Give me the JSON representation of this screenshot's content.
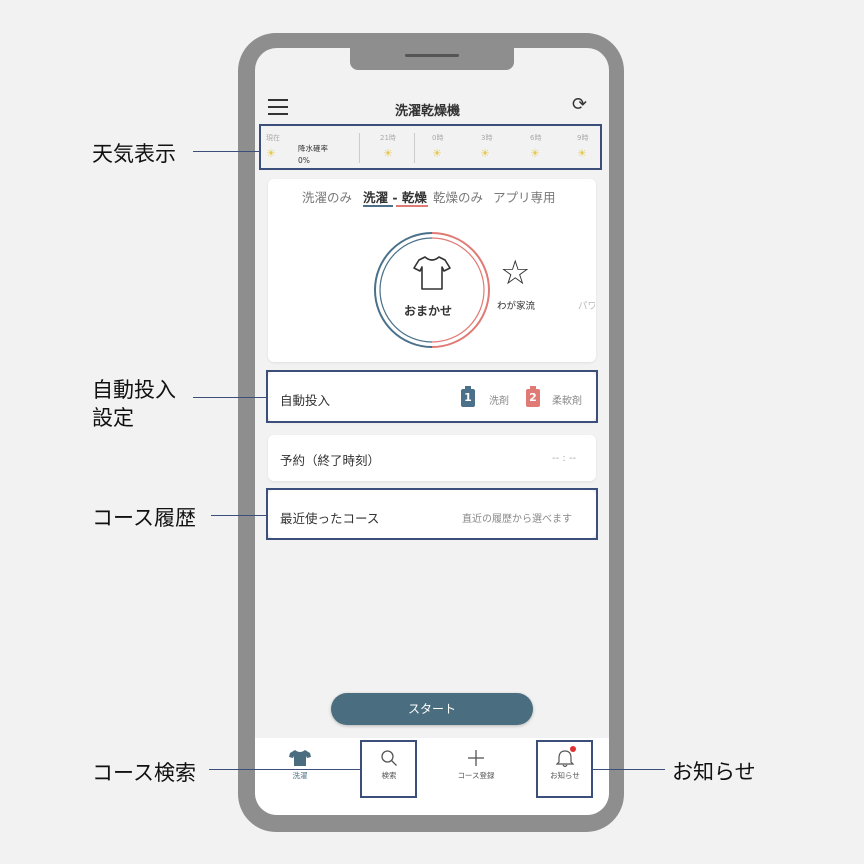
{
  "app": {
    "title": "洗濯乾燥機"
  },
  "weather": {
    "now_label": "現在",
    "rain_label": "降水確率",
    "rain_value": "0%",
    "times": [
      "21時",
      "0時",
      "3時",
      "6時",
      "9時"
    ]
  },
  "tabs": [
    "洗濯のみ",
    "洗濯 - 乾燥",
    "乾燥のみ",
    "アプリ専用"
  ],
  "active_tab": "洗濯 - 乾燥",
  "courses": {
    "main": "おまかせ",
    "second": "わが家流",
    "third_partial": "パワ"
  },
  "auto_dose": {
    "label": "自動投入",
    "slot1_number": "1",
    "slot1_label": "洗剤",
    "slot2_number": "2",
    "slot2_label": "柔軟剤"
  },
  "reservation": {
    "label": "予約（終了時刻）",
    "value": "-- : --"
  },
  "recent": {
    "label": "最近使ったコース",
    "hint": "直近の履歴から選べます"
  },
  "start_label": "スタート",
  "nav": {
    "wash": "洗濯",
    "search": "検索",
    "register": "コース登録",
    "notice": "お知らせ"
  },
  "annotations": {
    "weather": "天気表示",
    "auto_dose_line1": "自動投入",
    "auto_dose_line2": "設定",
    "history": "コース履歴",
    "search": "コース検索",
    "notice": "お知らせ"
  },
  "colors": {
    "wash_blue": "#4a7189",
    "dry_red": "#e07a74",
    "callout": "#3b4f7a",
    "start_button": "#4a6e80",
    "notice_dot": "#e03030"
  },
  "icons": {
    "menu": "hamburger-icon",
    "refresh": "refresh-icon",
    "weather": "sun-cloud-icon",
    "tshirt": "tshirt-icon",
    "star": "star-icon",
    "search": "search-icon",
    "plus": "plus-icon",
    "bell": "bell-icon"
  }
}
